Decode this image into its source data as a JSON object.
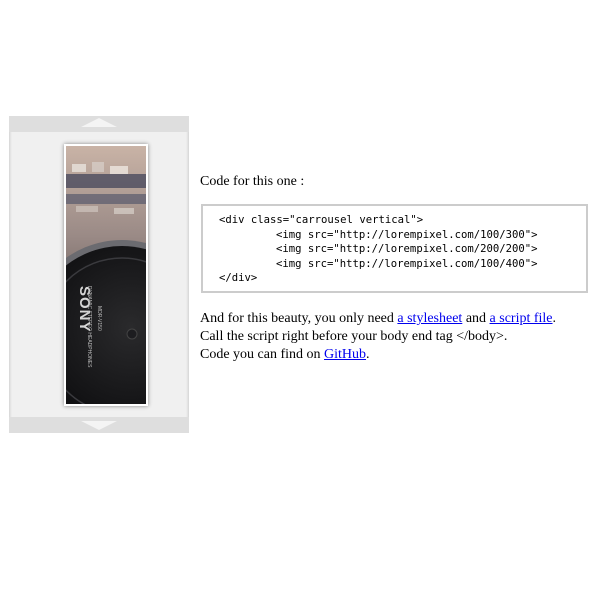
{
  "carousel": {
    "up_arrow_icon": "chevron-up-icon",
    "down_arrow_icon": "chevron-down-icon",
    "slide_brand": "SONY",
    "slide_caption": "DYNAMIC STEREO HEADPHONES",
    "slide_model": "MDR-V150"
  },
  "intro_text": "Code for this one :",
  "code": {
    "line1": "<div class=\"carrousel vertical\">",
    "line2": "<img src=\"http://lorempixel.com/100/300\">",
    "line3": "<img src=\"http://lorempixel.com/200/200\">",
    "line4": "<img src=\"http://lorempixel.com/100/400\">",
    "line5": "</div>"
  },
  "notes": {
    "line1_prefix": "And for this beauty, you only need ",
    "stylesheet_link": "a stylesheet",
    "line1_middle": " and ",
    "script_link": "a script file",
    "line1_suffix": ".",
    "line2": "Call the script right before your body end tag </body>.",
    "line3_prefix": "Code you can find on ",
    "github_link": "GitHub",
    "line3_suffix": "."
  },
  "colors": {
    "link": "#0000ee",
    "carousel_bg": "#f0f0f0",
    "nav_bar": "#dedede",
    "code_border": "#cccccc"
  }
}
